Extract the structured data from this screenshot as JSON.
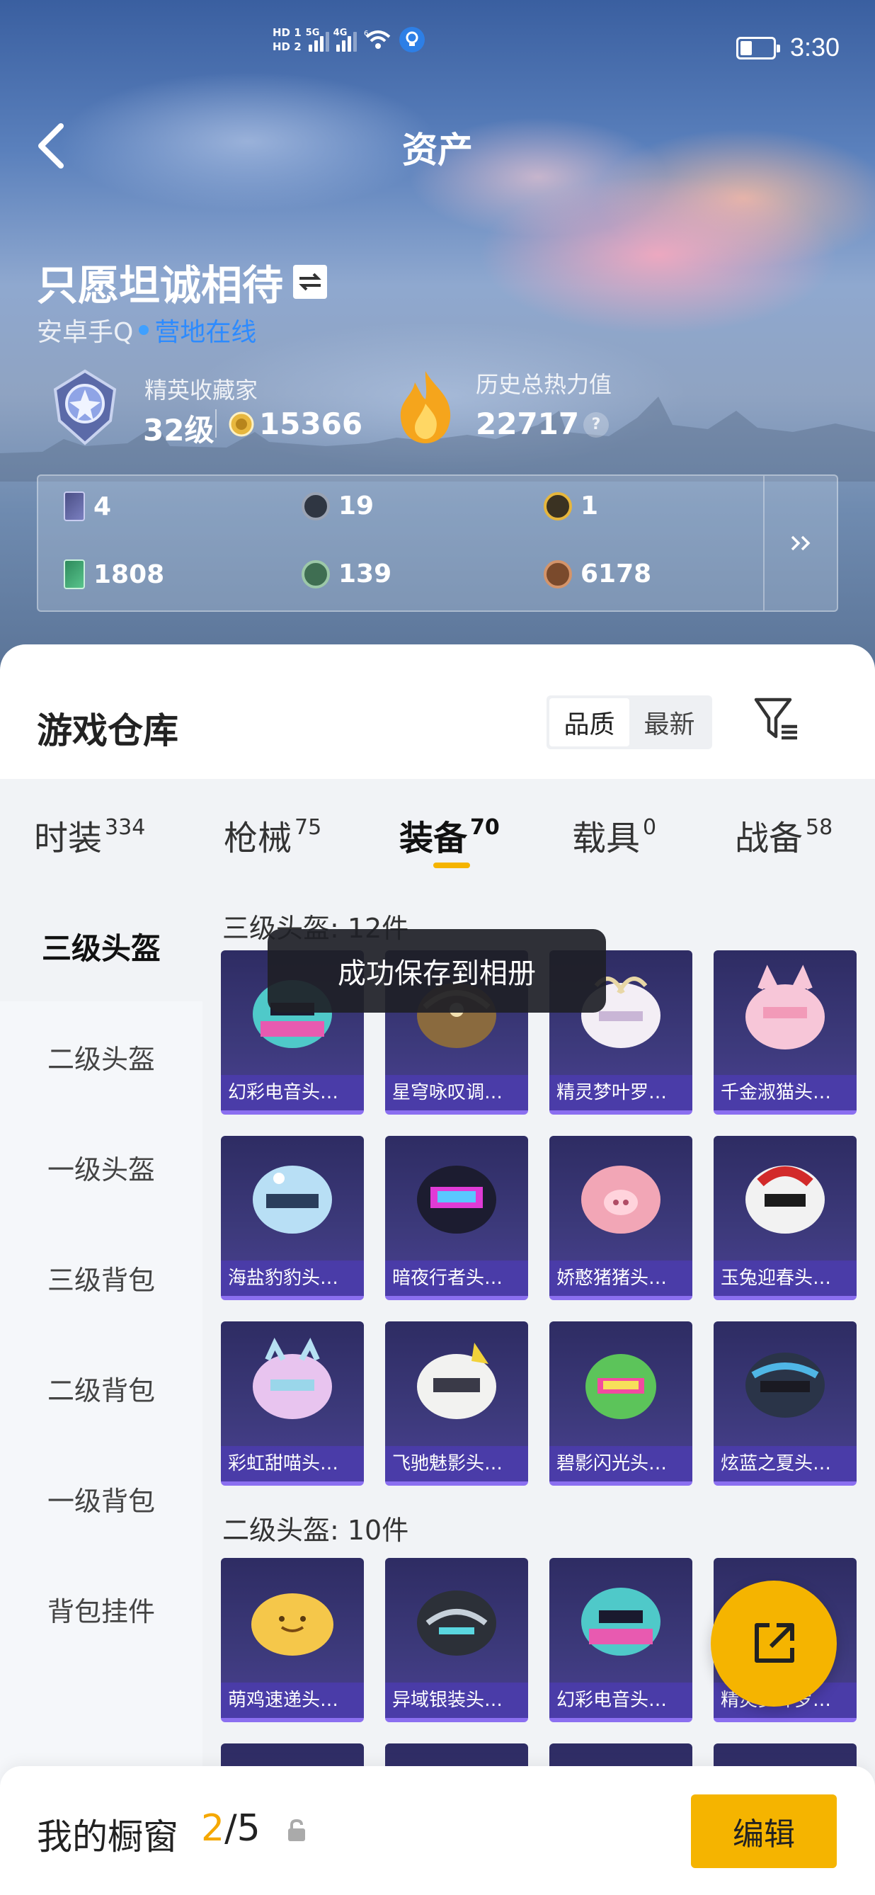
{
  "status_bar": {
    "hd1": "HD 1",
    "hd2": "HD 2",
    "sig1": "5G",
    "sig2": "4G",
    "wifi_label": "6",
    "time": "3:30"
  },
  "header": {
    "title": "资产"
  },
  "profile": {
    "nickname": "只愿坦诚相待",
    "platform": "安卓手Q",
    "online_status": "营地在线",
    "rank_title": "精英收藏家",
    "rank_level": "32级",
    "coins": "15366",
    "heat_title": "历史总热力值",
    "heat_value": "22717",
    "help_label": "?"
  },
  "stats": [
    {
      "icon": "card-icon",
      "value": "4"
    },
    {
      "icon": "silver-coin-icon",
      "value": "19"
    },
    {
      "icon": "gold-medal-icon",
      "value": "1"
    },
    {
      "icon": "ticket-icon",
      "value": "1808"
    },
    {
      "icon": "green-token-icon",
      "value": "139"
    },
    {
      "icon": "bronze-token-icon",
      "value": "6178"
    }
  ],
  "warehouse": {
    "title": "游戏仓库",
    "sort_options": [
      "品质",
      "最新"
    ],
    "active_sort": "品质",
    "categories": [
      {
        "label": "时装",
        "count": "334"
      },
      {
        "label": "枪械",
        "count": "75"
      },
      {
        "label": "装备",
        "count": "70"
      },
      {
        "label": "载具",
        "count": "0"
      },
      {
        "label": "战备",
        "count": "58"
      }
    ],
    "active_category": "装备",
    "side_nav": [
      "三级头盔",
      "二级头盔",
      "一级头盔",
      "三级背包",
      "二级背包",
      "一级背包",
      "背包挂件"
    ],
    "active_side": "三级头盔",
    "sections": [
      {
        "title": "三级头盔: 12件",
        "items": [
          "幻彩电音头…",
          "星穹咏叹调…",
          "精灵梦叶罗…",
          "千金淑猫头…",
          "海盐豹豹头…",
          "暗夜行者头…",
          "娇憨猪猪头…",
          "玉兔迎春头…",
          "彩虹甜喵头…",
          "飞驰魅影头…",
          "碧影闪光头…",
          "炫蓝之夏头…"
        ]
      },
      {
        "title": "二级头盔: 10件",
        "items": [
          "萌鸡速递头…",
          "异域银装头…",
          "幻彩电音头…",
          "精灵梦叶罗…"
        ]
      }
    ]
  },
  "toast": "成功保存到相册",
  "showcase": {
    "label": "我的橱窗",
    "current": "2",
    "total": "/5",
    "edit_label": "编辑"
  },
  "colors": {
    "accent": "#f5b400",
    "online": "#2d8bff",
    "item_bg": "#3d3a7c",
    "item_label_bg": "#4b3caa"
  }
}
